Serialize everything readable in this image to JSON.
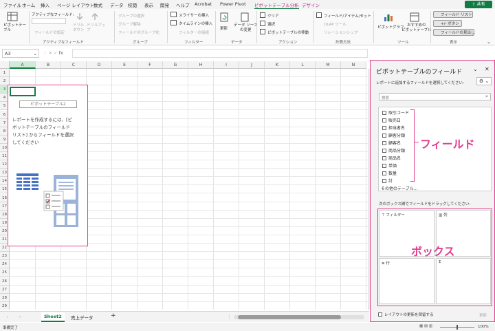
{
  "tabs": [
    "ファイル",
    "ホーム",
    "挿入",
    "ページ レイアウト",
    "数式",
    "データ",
    "校閲",
    "表示",
    "開発",
    "ヘルプ",
    "Acrobat",
    "Power Pivot",
    "ピボットテーブル分析",
    "デザイン"
  ],
  "share_label": "共有",
  "ribbon": {
    "groups": {
      "pivot": "ピボットテー\nブル",
      "active_field": "アクティブなフィールド",
      "group": "グループ",
      "filter": "フィルター",
      "data": "データ",
      "action": "アクション",
      "calc": "計算方法",
      "tools": "ツール",
      "show": "表示"
    },
    "active_field_label": "アクティブなフィールド:",
    "field_settings": "フィールドの設定",
    "drill_down": "ドリル\nダウン",
    "drill_up": "ドリルアッ\nプ",
    "group_selection": "グループの選択",
    "ungroup": "グループ解除",
    "group_field": "フィールドのグループ化",
    "insert_slicer": "スライサーの挿入",
    "insert_timeline": "タイムラインの挿入",
    "filter_connections": "フィルターの接続",
    "refresh": "更新",
    "change_source": "データ ソース\nの変更",
    "clear": "クリア",
    "select": "選択",
    "move_pivot": "ピボットテーブルの移動",
    "fields_items_sets": "フィールド/アイテム/セット",
    "olap_tools": "OLAP ツール",
    "relationships": "リレーションシップ",
    "pivot_chart": "ピボットグラフ",
    "recommended": "おすすめの\nピボットテーブル",
    "field_list": "フィールド リスト",
    "plus_minus": "+/- ボタン",
    "field_headers": "フィールドの見出し"
  },
  "formula_bar": {
    "name_box": "A3",
    "fx": "fx",
    "value": ""
  },
  "columns": [
    "A",
    "B",
    "C",
    "D",
    "E",
    "F",
    "G",
    "H",
    "I",
    "J",
    "K",
    "L",
    "M",
    "N"
  ],
  "rows": [
    "1",
    "2",
    "3",
    "4",
    "5",
    "6",
    "7",
    "8",
    "9",
    "10",
    "11",
    "12",
    "13",
    "14",
    "15",
    "16",
    "17",
    "18",
    "19",
    "20",
    "21",
    "22",
    "23",
    "24",
    "25",
    "26",
    "27",
    "28",
    "29"
  ],
  "pivot_placeholder": {
    "title": "ピボットテーブル2",
    "text": [
      "レポートを作成するには、[ピ",
      "ボットテーブルのフィールド",
      "リスト] からフィールドを選択",
      "してください"
    ]
  },
  "sheets": [
    "Sheet2",
    "売上データ"
  ],
  "status": {
    "ready": "準備完了",
    "zoom": "100%"
  },
  "pane": {
    "title": "ピボットテーブルのフィールド",
    "subtitle": "レポートに追加するフィールドを選択してください:",
    "search_placeholder": "検索",
    "fields": [
      "取引コード",
      "販売日",
      "担当者名",
      "顧客分類",
      "顧客名",
      "商品分類",
      "商品名",
      "単価",
      "数量",
      "計"
    ],
    "more_tables": "その他のテーブル...",
    "drag_hint": "次のボックス間でフィールドをドラッグしてください:",
    "areas": {
      "filter": "フィルター",
      "columns": "列",
      "rows": "行",
      "values": ""
    },
    "defer": "レイアウトの更新を保留する",
    "update": "更新"
  },
  "annotations": {
    "fields": "フィールド",
    "boxes": "ボックス"
  },
  "accent": "#107c41",
  "highlight": "#e0408f"
}
